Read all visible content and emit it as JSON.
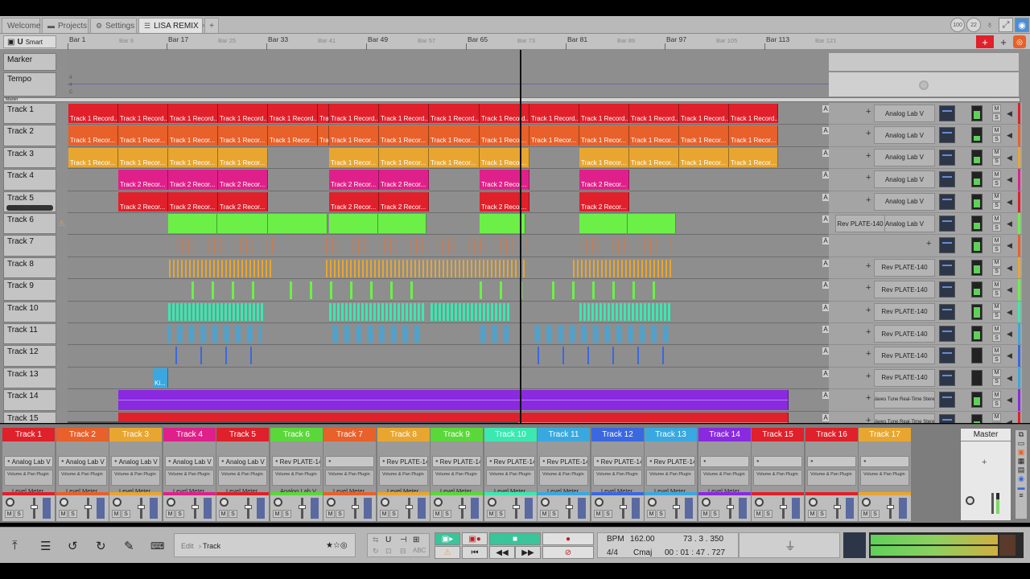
{
  "tabs": [
    {
      "label": "Welcome",
      "icon": ""
    },
    {
      "label": "Projects",
      "icon": "folder-icon"
    },
    {
      "label": "Settings",
      "icon": "gear-icon"
    },
    {
      "label": "LISA REMIX",
      "icon": "tracks-icon",
      "close": "×"
    }
  ],
  "tab_add": "+",
  "top_right": {
    "badge1": "100",
    "badge2": "22"
  },
  "snap": {
    "label": "Smart"
  },
  "ruler": {
    "major": [
      "Bar 1",
      "Bar 17",
      "Bar 33",
      "Bar 49",
      "Bar 65",
      "Bar 81",
      "Bar 97",
      "Bar 113"
    ],
    "minor": [
      "Bar 9",
      "Bar 25",
      "Bar 41",
      "Bar 57",
      "Bar 73",
      "Bar 89",
      "Bar 105",
      "Bar 121"
    ]
  },
  "marker_label": "Marker",
  "tempo_label": "Tempo",
  "master_small": "Master",
  "tempo_ticks": [
    "4",
    "4",
    "C"
  ],
  "tracks": [
    {
      "name": "Track 1",
      "color": "#e0202a",
      "clip": "Track 1 Record...",
      "plugin": "Analog Lab V"
    },
    {
      "name": "Track 2",
      "color": "#e8602a",
      "clip": "Track 1 Recor...",
      "plugin": "Analog Lab V"
    },
    {
      "name": "Track 3",
      "color": "#e8a630",
      "clip": "Track 1 Recor...",
      "plugin": "Analog Lab V"
    },
    {
      "name": "Track 4",
      "color": "#e0208a",
      "clip": "Track 2 Recor...",
      "plugin": "Analog Lab V"
    },
    {
      "name": "Track 5",
      "color": "#e0202a",
      "clip": "Track 2 Recor...",
      "plugin": "Analog Lab V"
    },
    {
      "name": "Track 6",
      "color": "#6cf048",
      "clip": "",
      "plugin": "Analog Lab V",
      "extra": "Rev PLATE-140"
    },
    {
      "name": "Track 7",
      "color": "#e8602a",
      "clip": "",
      "plugin": ""
    },
    {
      "name": "Track 8",
      "color": "#e8a630",
      "clip": "",
      "plugin": "Rev PLATE-140"
    },
    {
      "name": "Track 9",
      "color": "#6cf048",
      "clip": "",
      "plugin": "Rev PLATE-140"
    },
    {
      "name": "Track 10",
      "color": "#3ae8b0",
      "clip": "",
      "plugin": "Rev PLATE-140"
    },
    {
      "name": "Track 11",
      "color": "#3aa8e0",
      "clip": "",
      "plugin": "Rev PLATE-140"
    },
    {
      "name": "Track 12",
      "color": "#3a68e0",
      "clip": "",
      "plugin": "Rev PLATE-140"
    },
    {
      "name": "Track 13",
      "color": "#3aa8e0",
      "clip": "Ki...",
      "plugin": "Rev PLATE-140"
    },
    {
      "name": "Track 14",
      "color": "#8a2ae0",
      "clip": "",
      "plugin": "Waves Tune Real-Time Stereo"
    },
    {
      "name": "Track 15",
      "color": "#e0202a",
      "clip": "",
      "plugin": "Waves Tune Real-Time Stereo"
    }
  ],
  "mixer": {
    "channels": [
      {
        "name": "Track 1",
        "color": "#e0202a",
        "plugin": "Analog Lab V",
        "level": "Level Meter"
      },
      {
        "name": "Track 2",
        "color": "#e8602a",
        "plugin": "Analog Lab V",
        "level": "Level Meter"
      },
      {
        "name": "Track 3",
        "color": "#e8a630",
        "plugin": "Analog Lab V",
        "level": "Level Meter"
      },
      {
        "name": "Track 4",
        "color": "#e0208a",
        "plugin": "Analog Lab V",
        "level": "Level Meter"
      },
      {
        "name": "Track 5",
        "color": "#e0202a",
        "plugin": "Analog Lab V",
        "level": "Level Meter"
      },
      {
        "name": "Track 6",
        "color": "#5ad83a",
        "plugin": "Rev PLATE-140",
        "level": "Analog Lab V"
      },
      {
        "name": "Track 7",
        "color": "#e8602a",
        "plugin": "",
        "level": "Level Meter"
      },
      {
        "name": "Track 8",
        "color": "#e8a630",
        "plugin": "Rev PLATE-140",
        "level": "Level Meter"
      },
      {
        "name": "Track 9",
        "color": "#5ad83a",
        "plugin": "Rev PLATE-140",
        "level": "Level Meter"
      },
      {
        "name": "Track 10",
        "color": "#3ae8b0",
        "plugin": "Rev PLATE-140",
        "level": "Level Meter"
      },
      {
        "name": "Track 11",
        "color": "#3aa8e0",
        "plugin": "Rev PLATE-140",
        "level": "Level Meter"
      },
      {
        "name": "Track 12",
        "color": "#3a68e0",
        "plugin": "Rev PLATE-140",
        "level": "Level Meter"
      },
      {
        "name": "Track 13",
        "color": "#3aa8e0",
        "plugin": "Rev PLATE-140",
        "level": "Level Meter"
      },
      {
        "name": "Track 14",
        "color": "#8a2ae0",
        "plugin": "",
        "level": "Level Meter"
      },
      {
        "name": "Track 15",
        "color": "#e0202a",
        "plugin": "",
        "level": ""
      },
      {
        "name": "Track 16",
        "color": "#e0202a",
        "plugin": "",
        "level": ""
      },
      {
        "name": "Track 17",
        "color": "#e8a630",
        "plugin": "",
        "level": ""
      }
    ],
    "master": "Master",
    "sub_text": "Volume\n& Pan Plugin"
  },
  "toolbar": {
    "edit_path": "Edit",
    "edit_sep": "›",
    "edit_target": "Track",
    "bpm_label": "BPM",
    "bpm_value": "162.00",
    "position": "73 . 3 . 350",
    "time_sig": "4/4",
    "key": "Cmaj",
    "time": "00 : 01 : 47 . 727"
  }
}
